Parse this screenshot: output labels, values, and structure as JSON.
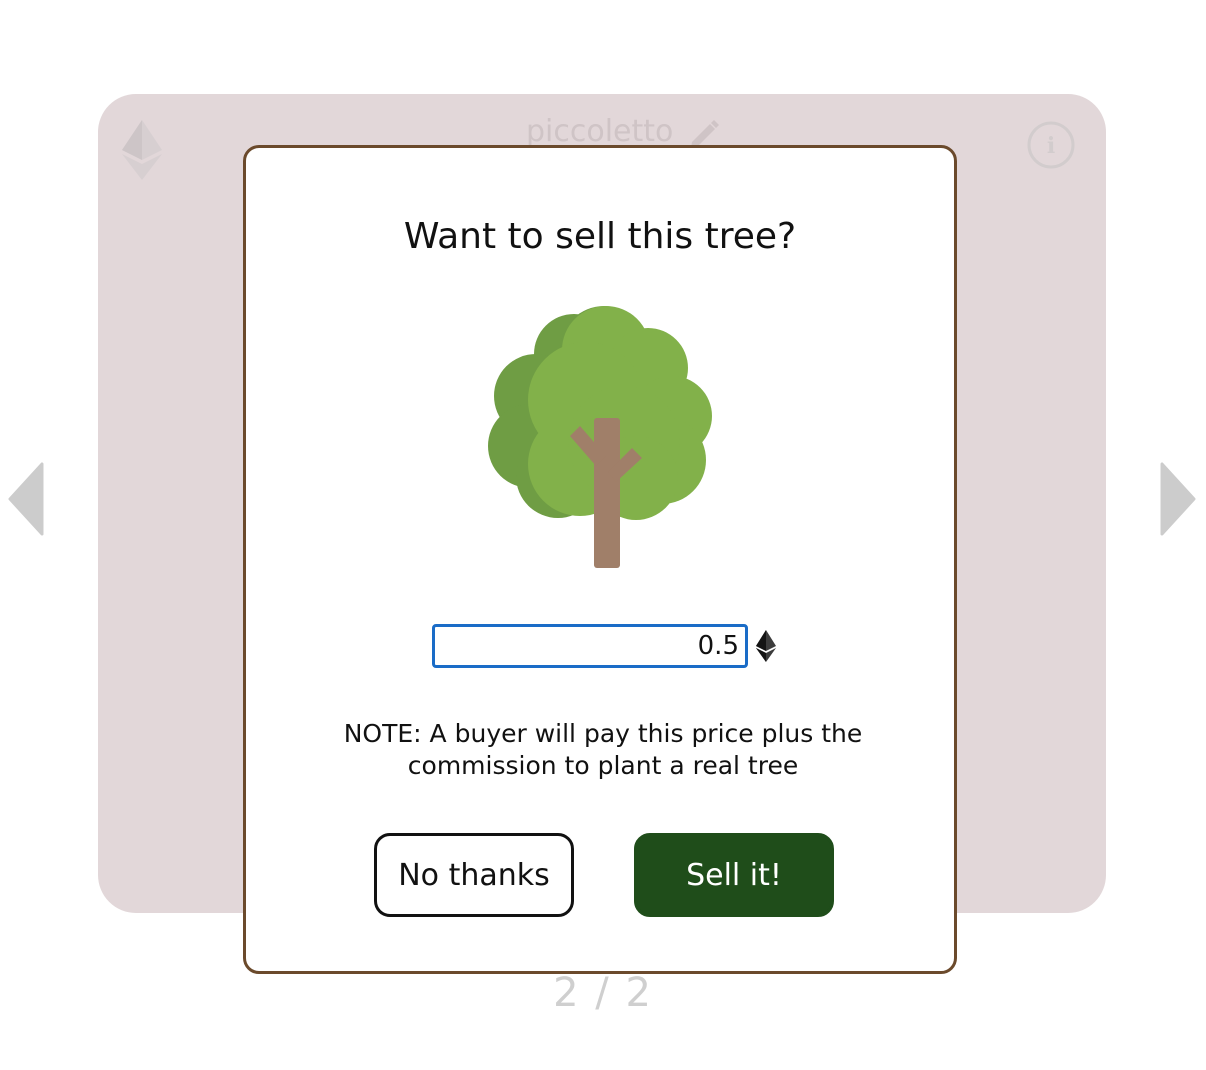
{
  "background_card": {
    "name": "piccoletto",
    "currency_icon": "ethereum-icon",
    "edit_icon": "pencil-icon",
    "info_icon": "info-icon"
  },
  "navigation": {
    "prev_icon": "arrow-left-icon",
    "next_icon": "arrow-right-icon",
    "pager": "2 / 2"
  },
  "modal": {
    "title": "Want to sell this tree?",
    "illustration": "tree-icon",
    "price": {
      "value": "0.5",
      "currency_icon": "ethereum-icon"
    },
    "note": "NOTE: A buyer will pay this price plus the commission to plant a real tree",
    "buttons": {
      "cancel": "No thanks",
      "confirm": "Sell it!"
    }
  },
  "colors": {
    "card_background": "#e2d7d9",
    "modal_border": "#6b4a2c",
    "confirm_button": "#1f4d1a",
    "input_border": "#1a6cc7",
    "tree_foliage_light": "#82b14a",
    "tree_foliage_dark": "#6f9d44",
    "tree_trunk": "#a07f69"
  }
}
